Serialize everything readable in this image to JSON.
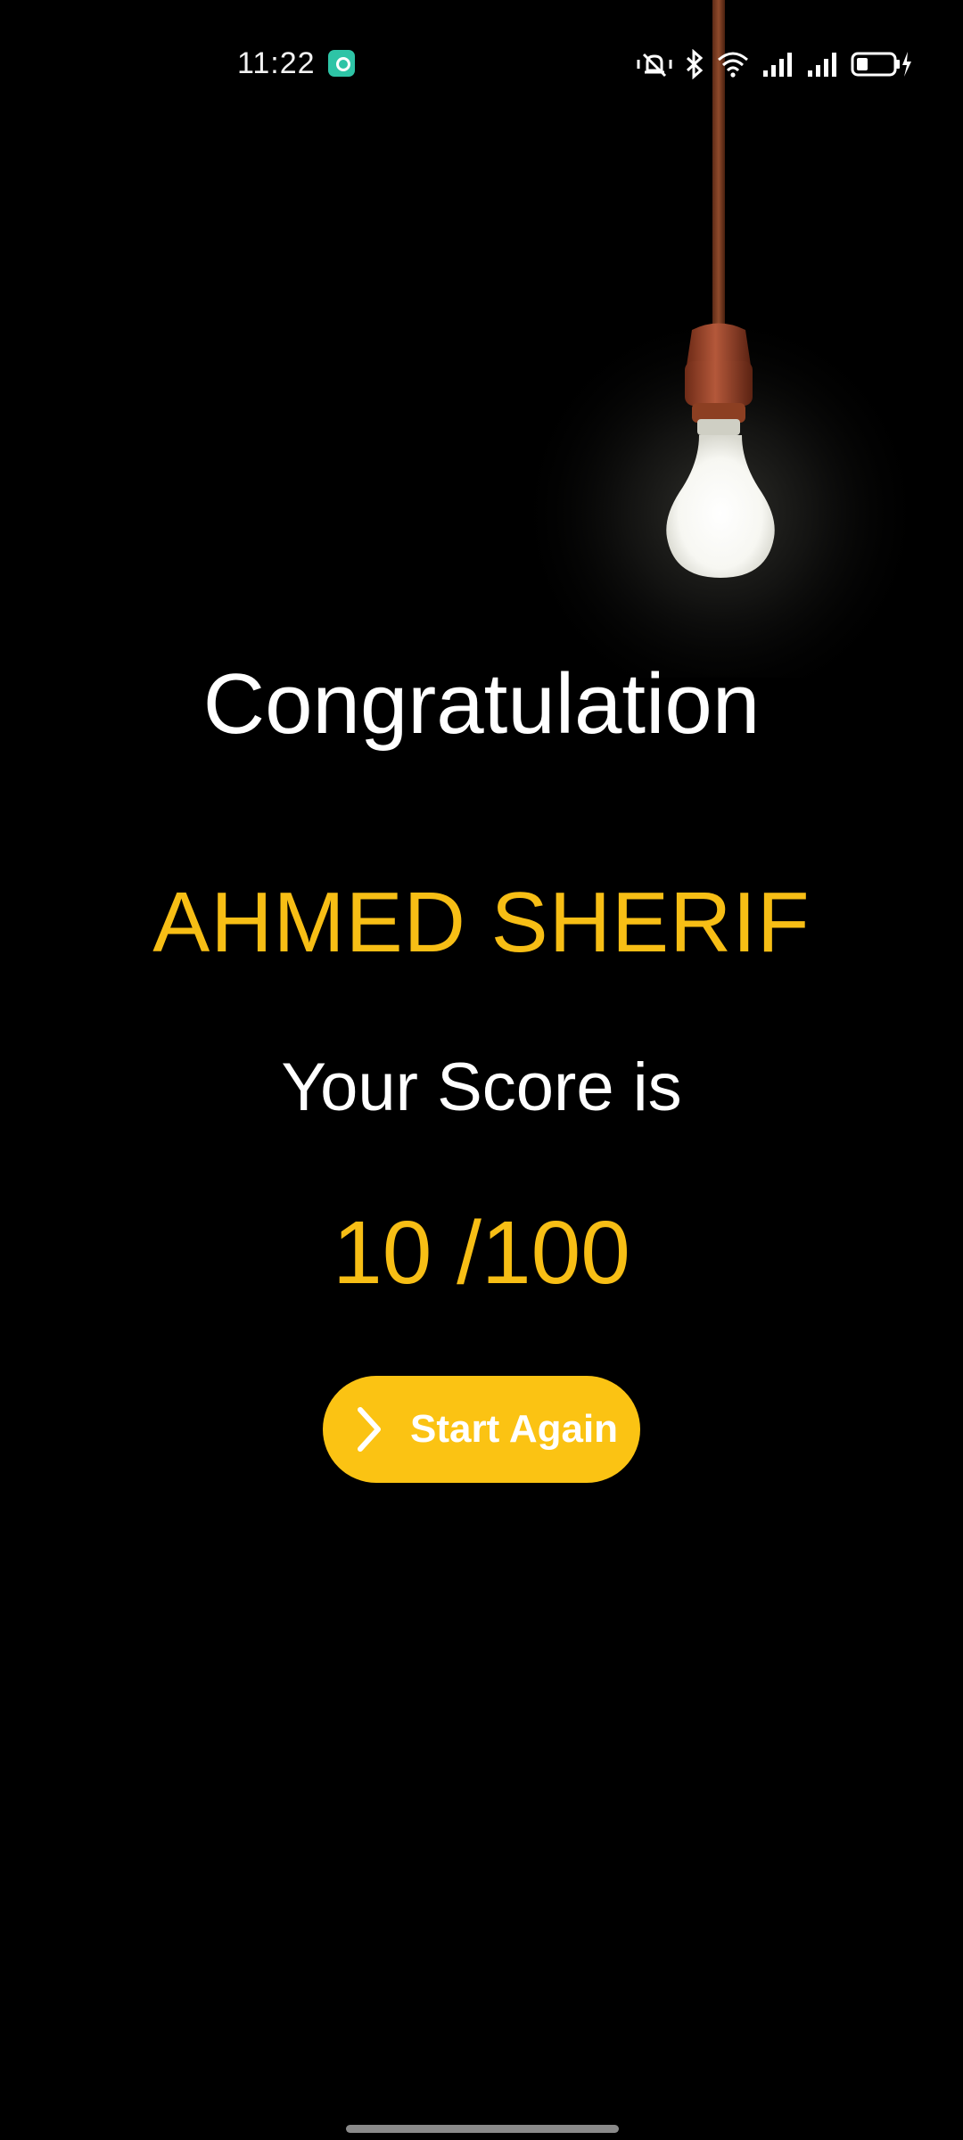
{
  "status_bar": {
    "time": "11:22",
    "icons": [
      "app-notification-icon",
      "mute-vibrate-icon",
      "bluetooth-icon",
      "wifi-icon",
      "signal-icon",
      "signal-icon",
      "battery-charging-icon"
    ]
  },
  "result": {
    "title": "Congratulation",
    "player_name": "AHMED SHERIF",
    "score_label": "Your Score is",
    "score_value": "10 /100"
  },
  "actions": {
    "start_again_label": "Start Again"
  },
  "colors": {
    "background": "#000000",
    "accent": "#f7be15",
    "button": "#fbc313",
    "text": "#ffffff"
  }
}
